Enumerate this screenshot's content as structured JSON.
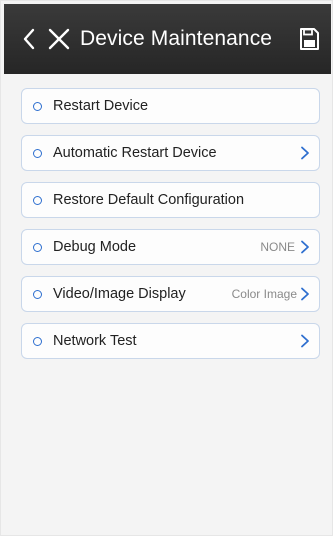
{
  "header": {
    "title": "Device Maintenance",
    "back_icon": "chevron-left-icon",
    "close_icon": "close-icon",
    "save_icon": "save-icon"
  },
  "menu": {
    "items": [
      {
        "label": "Restart Device",
        "value": "",
        "has_arrow": false
      },
      {
        "label": "Automatic Restart Device",
        "value": "",
        "has_arrow": true
      },
      {
        "label": "Restore Default Configuration",
        "value": "",
        "has_arrow": false
      },
      {
        "label": "Debug Mode",
        "value": "NONE",
        "has_arrow": true
      },
      {
        "label": "Video/Image Display",
        "value": "Color Image",
        "has_arrow": true
      },
      {
        "label": "Network Test",
        "value": "",
        "has_arrow": true
      }
    ]
  },
  "colors": {
    "header_bg": "#2e2e2e",
    "accent": "#2e6fcf",
    "row_border": "#c9d7ea",
    "page_bg": "#f4f4f4"
  }
}
